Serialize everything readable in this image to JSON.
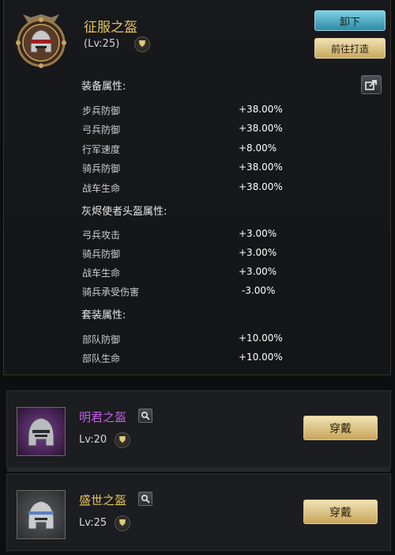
{
  "equipped": {
    "name": "征服之盔",
    "level_text": "(Lv:25)",
    "unequip_label": "卸下",
    "forge_label": "前往打造",
    "name_color": "#e7c35b"
  },
  "sections": {
    "equip_attrs_title": "装备属性:",
    "equip_attrs": [
      {
        "name": "步兵防御",
        "value": "+38.00%"
      },
      {
        "name": "弓兵防御",
        "value": "+38.00%"
      },
      {
        "name": "行军速度",
        "value": "+8.00%"
      },
      {
        "name": "骑兵防御",
        "value": "+38.00%"
      },
      {
        "name": "战车生命",
        "value": "+38.00%"
      }
    ],
    "helm_attrs_title": "灰烬使者头盔属性:",
    "helm_attrs": [
      {
        "name": "弓兵攻击",
        "value": "+3.00%"
      },
      {
        "name": "骑兵防御",
        "value": "+3.00%"
      },
      {
        "name": "战车生命",
        "value": "+3.00%"
      },
      {
        "name": "骑兵承受伤害",
        "value": "-3.00%"
      }
    ],
    "set_attrs_title": "套装属性:",
    "set_attrs": [
      {
        "name": "部队防御",
        "value": "+10.00%"
      },
      {
        "name": "部队生命",
        "value": "+10.00%"
      }
    ]
  },
  "items": [
    {
      "name": "明君之盔",
      "level_text": "Lv:20",
      "equip_label": "穿戴",
      "name_color": "#c55ce8"
    },
    {
      "name": "盛世之盔",
      "level_text": "Lv:25",
      "equip_label": "穿戴",
      "name_color": "#e7c35b"
    }
  ],
  "icons": {
    "level": "armor-icon",
    "share": "share-icon",
    "search": "search-icon"
  }
}
